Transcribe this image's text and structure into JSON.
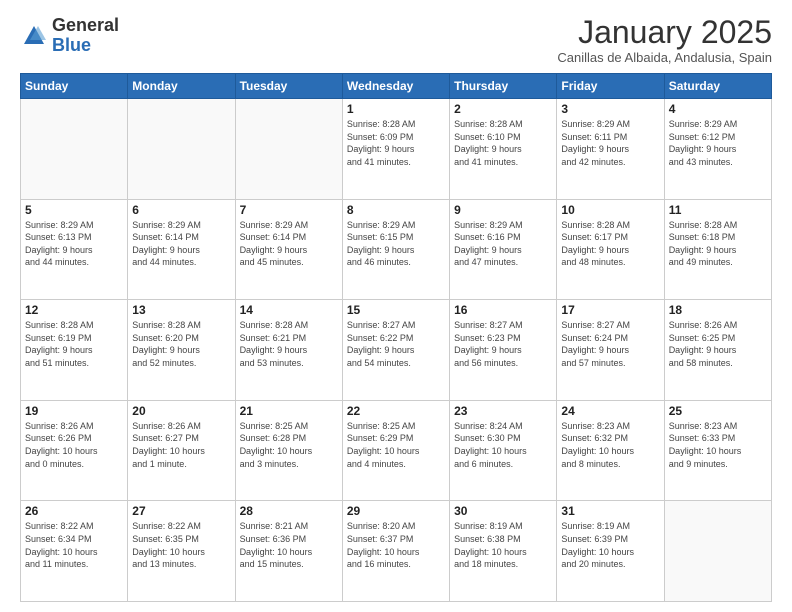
{
  "header": {
    "logo_general": "General",
    "logo_blue": "Blue",
    "month_title": "January 2025",
    "location": "Canillas de Albaida, Andalusia, Spain"
  },
  "days_of_week": [
    "Sunday",
    "Monday",
    "Tuesday",
    "Wednesday",
    "Thursday",
    "Friday",
    "Saturday"
  ],
  "weeks": [
    [
      {
        "day": "",
        "info": ""
      },
      {
        "day": "",
        "info": ""
      },
      {
        "day": "",
        "info": ""
      },
      {
        "day": "1",
        "info": "Sunrise: 8:28 AM\nSunset: 6:09 PM\nDaylight: 9 hours\nand 41 minutes."
      },
      {
        "day": "2",
        "info": "Sunrise: 8:28 AM\nSunset: 6:10 PM\nDaylight: 9 hours\nand 41 minutes."
      },
      {
        "day": "3",
        "info": "Sunrise: 8:29 AM\nSunset: 6:11 PM\nDaylight: 9 hours\nand 42 minutes."
      },
      {
        "day": "4",
        "info": "Sunrise: 8:29 AM\nSunset: 6:12 PM\nDaylight: 9 hours\nand 43 minutes."
      }
    ],
    [
      {
        "day": "5",
        "info": "Sunrise: 8:29 AM\nSunset: 6:13 PM\nDaylight: 9 hours\nand 44 minutes."
      },
      {
        "day": "6",
        "info": "Sunrise: 8:29 AM\nSunset: 6:14 PM\nDaylight: 9 hours\nand 44 minutes."
      },
      {
        "day": "7",
        "info": "Sunrise: 8:29 AM\nSunset: 6:14 PM\nDaylight: 9 hours\nand 45 minutes."
      },
      {
        "day": "8",
        "info": "Sunrise: 8:29 AM\nSunset: 6:15 PM\nDaylight: 9 hours\nand 46 minutes."
      },
      {
        "day": "9",
        "info": "Sunrise: 8:29 AM\nSunset: 6:16 PM\nDaylight: 9 hours\nand 47 minutes."
      },
      {
        "day": "10",
        "info": "Sunrise: 8:28 AM\nSunset: 6:17 PM\nDaylight: 9 hours\nand 48 minutes."
      },
      {
        "day": "11",
        "info": "Sunrise: 8:28 AM\nSunset: 6:18 PM\nDaylight: 9 hours\nand 49 minutes."
      }
    ],
    [
      {
        "day": "12",
        "info": "Sunrise: 8:28 AM\nSunset: 6:19 PM\nDaylight: 9 hours\nand 51 minutes."
      },
      {
        "day": "13",
        "info": "Sunrise: 8:28 AM\nSunset: 6:20 PM\nDaylight: 9 hours\nand 52 minutes."
      },
      {
        "day": "14",
        "info": "Sunrise: 8:28 AM\nSunset: 6:21 PM\nDaylight: 9 hours\nand 53 minutes."
      },
      {
        "day": "15",
        "info": "Sunrise: 8:27 AM\nSunset: 6:22 PM\nDaylight: 9 hours\nand 54 minutes."
      },
      {
        "day": "16",
        "info": "Sunrise: 8:27 AM\nSunset: 6:23 PM\nDaylight: 9 hours\nand 56 minutes."
      },
      {
        "day": "17",
        "info": "Sunrise: 8:27 AM\nSunset: 6:24 PM\nDaylight: 9 hours\nand 57 minutes."
      },
      {
        "day": "18",
        "info": "Sunrise: 8:26 AM\nSunset: 6:25 PM\nDaylight: 9 hours\nand 58 minutes."
      }
    ],
    [
      {
        "day": "19",
        "info": "Sunrise: 8:26 AM\nSunset: 6:26 PM\nDaylight: 10 hours\nand 0 minutes."
      },
      {
        "day": "20",
        "info": "Sunrise: 8:26 AM\nSunset: 6:27 PM\nDaylight: 10 hours\nand 1 minute."
      },
      {
        "day": "21",
        "info": "Sunrise: 8:25 AM\nSunset: 6:28 PM\nDaylight: 10 hours\nand 3 minutes."
      },
      {
        "day": "22",
        "info": "Sunrise: 8:25 AM\nSunset: 6:29 PM\nDaylight: 10 hours\nand 4 minutes."
      },
      {
        "day": "23",
        "info": "Sunrise: 8:24 AM\nSunset: 6:30 PM\nDaylight: 10 hours\nand 6 minutes."
      },
      {
        "day": "24",
        "info": "Sunrise: 8:23 AM\nSunset: 6:32 PM\nDaylight: 10 hours\nand 8 minutes."
      },
      {
        "day": "25",
        "info": "Sunrise: 8:23 AM\nSunset: 6:33 PM\nDaylight: 10 hours\nand 9 minutes."
      }
    ],
    [
      {
        "day": "26",
        "info": "Sunrise: 8:22 AM\nSunset: 6:34 PM\nDaylight: 10 hours\nand 11 minutes."
      },
      {
        "day": "27",
        "info": "Sunrise: 8:22 AM\nSunset: 6:35 PM\nDaylight: 10 hours\nand 13 minutes."
      },
      {
        "day": "28",
        "info": "Sunrise: 8:21 AM\nSunset: 6:36 PM\nDaylight: 10 hours\nand 15 minutes."
      },
      {
        "day": "29",
        "info": "Sunrise: 8:20 AM\nSunset: 6:37 PM\nDaylight: 10 hours\nand 16 minutes."
      },
      {
        "day": "30",
        "info": "Sunrise: 8:19 AM\nSunset: 6:38 PM\nDaylight: 10 hours\nand 18 minutes."
      },
      {
        "day": "31",
        "info": "Sunrise: 8:19 AM\nSunset: 6:39 PM\nDaylight: 10 hours\nand 20 minutes."
      },
      {
        "day": "",
        "info": ""
      }
    ]
  ]
}
